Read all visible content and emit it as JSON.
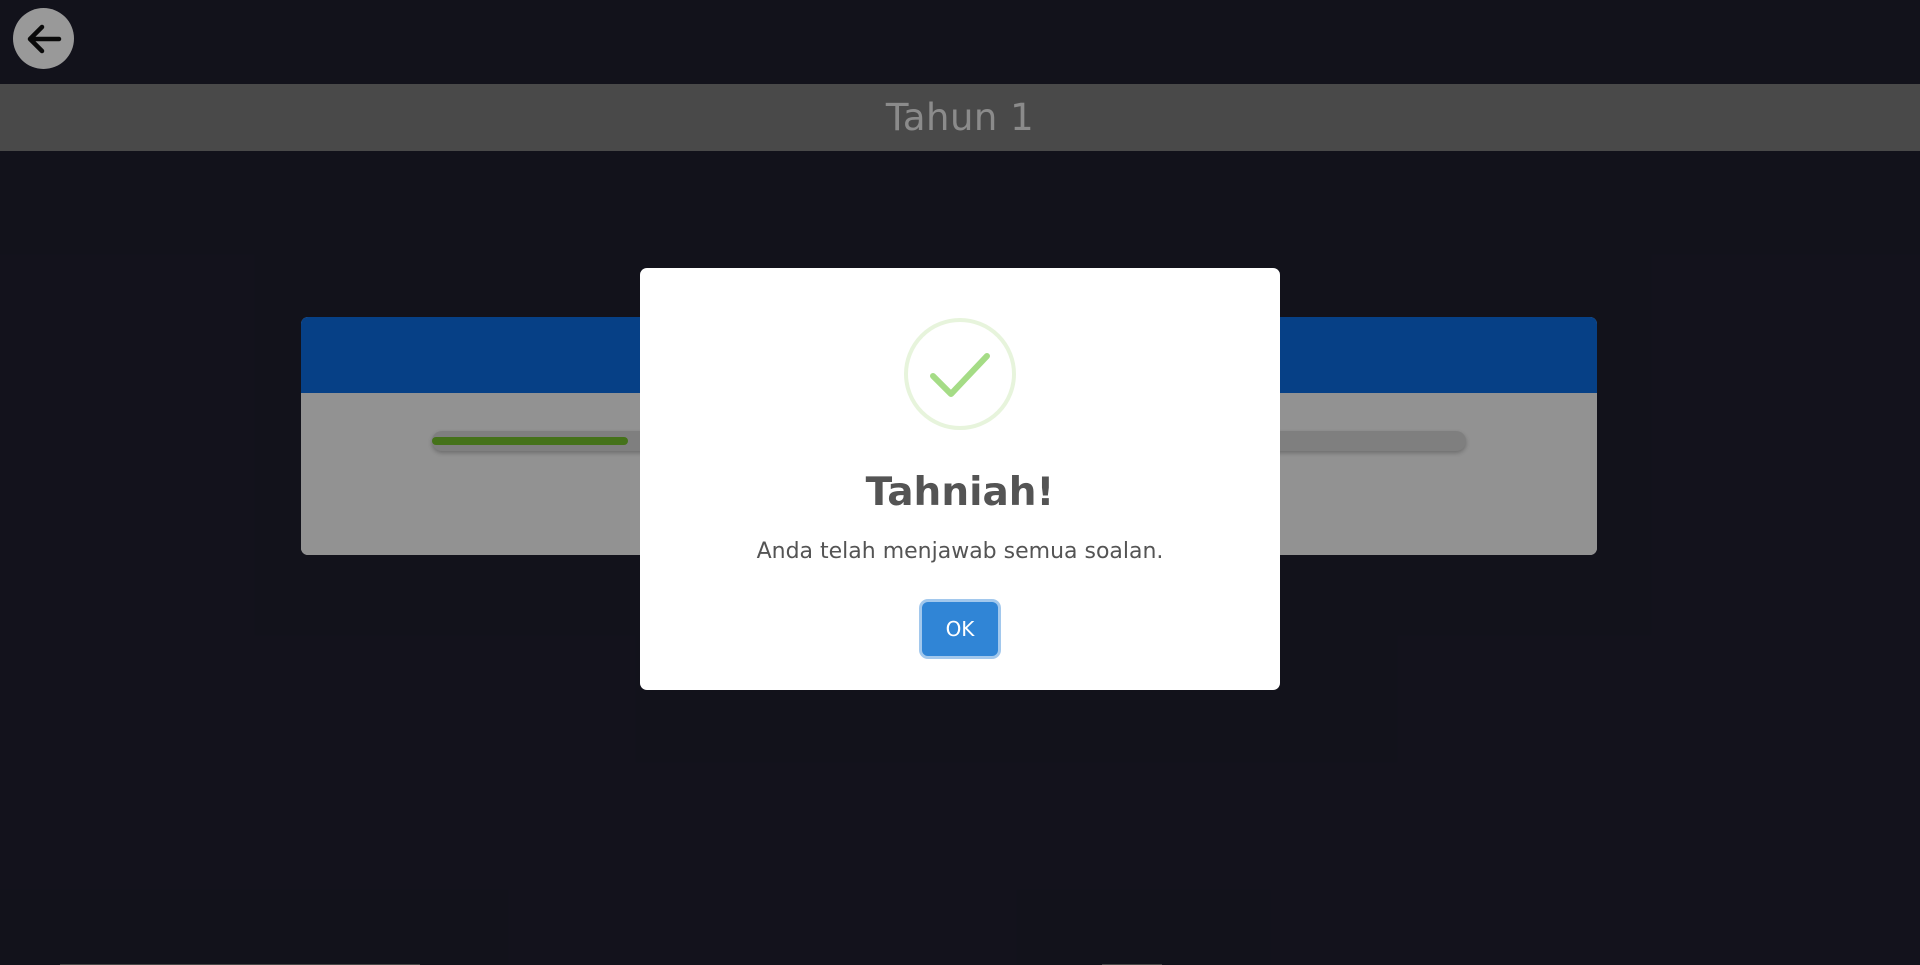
{
  "header": {
    "back_icon": "arrow-left-icon",
    "title": "Tahun 1"
  },
  "quiz_card": {
    "header_color": "#0a6be0",
    "progress_color": "#74bf2c",
    "progress_fraction": 0.19
  },
  "modal": {
    "icon": "check-circle-icon",
    "icon_color": "#a5dc86",
    "title": "Tahniah!",
    "message": "Anda telah menjawab semua soalan.",
    "ok_label": "OK",
    "button_color": "#3085d6"
  }
}
